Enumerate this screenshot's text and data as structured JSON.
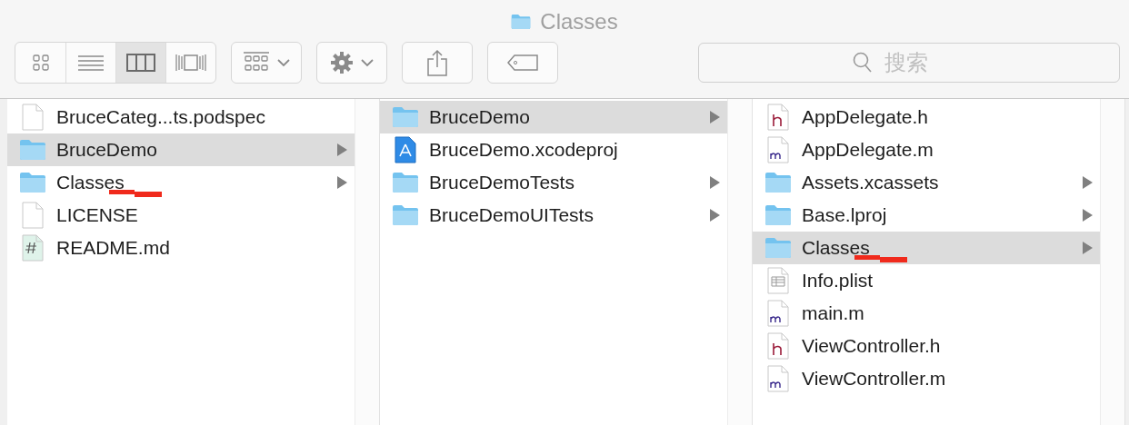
{
  "window": {
    "title": "Classes"
  },
  "toolbar": {
    "view_buttons": [
      {
        "kind": "icons",
        "selected": false
      },
      {
        "kind": "list",
        "selected": false
      },
      {
        "kind": "columns",
        "selected": true
      },
      {
        "kind": "gallery",
        "selected": false
      }
    ],
    "search": {
      "placeholder": "搜索"
    }
  },
  "columns": [
    {
      "items": [
        {
          "name": "BruceCateg...ts.podspec",
          "kind": "file",
          "selected": false,
          "expandable": false,
          "scribbled": false
        },
        {
          "name": "BruceDemo",
          "kind": "folder",
          "selected": true,
          "expandable": true,
          "scribbled": false
        },
        {
          "name": "Classes",
          "kind": "folder",
          "selected": false,
          "expandable": true,
          "scribbled": true
        },
        {
          "name": "LICENSE",
          "kind": "file",
          "selected": false,
          "expandable": false,
          "scribbled": false
        },
        {
          "name": "README.md",
          "kind": "markdown",
          "selected": false,
          "expandable": false,
          "scribbled": false
        }
      ]
    },
    {
      "items": [
        {
          "name": "BruceDemo",
          "kind": "folder",
          "selected": true,
          "expandable": true,
          "scribbled": false
        },
        {
          "name": "BruceDemo.xcodeproj",
          "kind": "xcodeproj",
          "selected": false,
          "expandable": false,
          "scribbled": false
        },
        {
          "name": "BruceDemoTests",
          "kind": "folder",
          "selected": false,
          "expandable": true,
          "scribbled": false
        },
        {
          "name": "BruceDemoUITests",
          "kind": "folder",
          "selected": false,
          "expandable": true,
          "scribbled": false
        }
      ]
    },
    {
      "items": [
        {
          "name": "AppDelegate.h",
          "kind": "header",
          "selected": false,
          "expandable": false,
          "scribbled": false
        },
        {
          "name": "AppDelegate.m",
          "kind": "source",
          "selected": false,
          "expandable": false,
          "scribbled": false
        },
        {
          "name": "Assets.xcassets",
          "kind": "folder",
          "selected": false,
          "expandable": true,
          "scribbled": false
        },
        {
          "name": "Base.lproj",
          "kind": "folder",
          "selected": false,
          "expandable": true,
          "scribbled": false
        },
        {
          "name": "Classes",
          "kind": "folder",
          "selected": true,
          "expandable": true,
          "scribbled": true
        },
        {
          "name": "Info.plist",
          "kind": "plist",
          "selected": false,
          "expandable": false,
          "scribbled": false
        },
        {
          "name": "main.m",
          "kind": "source",
          "selected": false,
          "expandable": false,
          "scribbled": false
        },
        {
          "name": "ViewController.h",
          "kind": "header",
          "selected": false,
          "expandable": false,
          "scribbled": false
        },
        {
          "name": "ViewController.m",
          "kind": "source",
          "selected": false,
          "expandable": false,
          "scribbled": false
        }
      ]
    }
  ]
}
